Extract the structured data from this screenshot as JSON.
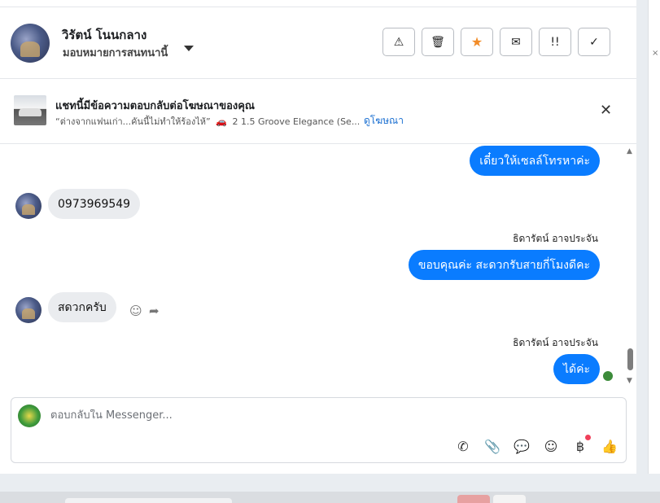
{
  "header": {
    "contact_name": "วิรัตน์ โนนกลาง",
    "assign_label": "มอบหมายการสนทนานี้",
    "actions": [
      {
        "icon": "warning-icon",
        "glyph": "⚠"
      },
      {
        "icon": "trash-icon",
        "glyph": "🗑"
      },
      {
        "icon": "star-icon",
        "glyph": "★"
      },
      {
        "icon": "envelope-icon",
        "glyph": "✉"
      },
      {
        "icon": "priority-icon",
        "glyph": "!!"
      },
      {
        "icon": "check-icon",
        "glyph": "✓"
      }
    ]
  },
  "ad": {
    "title": "แชทนี้มีข้อความตอบกลับต่อโฆษณาของคุณ",
    "quote": "“ต่างจากแฟนเก่า...คันนี้ไม่ทำให้ร้องไห้”",
    "car_icon": "🚗",
    "model": "2 1.5 Groove Elegance (Se...",
    "link": "ดูโฆษณา",
    "close": "✕"
  },
  "messages": [
    {
      "direction": "out",
      "text": "เดี๋ยวให้เซลล์โทรหาค่ะ"
    },
    {
      "direction": "in",
      "text": "0973969549"
    },
    {
      "direction": "out",
      "sender": "ธิดารัตน์ อาจประจัน",
      "text": "ขอบคุณค่ะ สะดวกรับสายกี่โมงดีคะ"
    },
    {
      "direction": "in",
      "text": "สดวกครับ",
      "react_glyph": "☺",
      "reply_glyph": "➦"
    },
    {
      "direction": "out",
      "sender": "ธิดารัตน์ อาจประจัน",
      "text": "ได้ค่ะ"
    }
  ],
  "composer": {
    "placeholder": "ตอบกลับใน Messenger...",
    "tools": [
      {
        "icon": "call-add-icon",
        "glyph": "✆"
      },
      {
        "icon": "paperclip-icon",
        "glyph": "📎"
      },
      {
        "icon": "chat-bubble-icon",
        "glyph": "💬"
      },
      {
        "icon": "emoji-icon",
        "glyph": "☺"
      },
      {
        "icon": "baht-icon",
        "glyph": "฿"
      },
      {
        "icon": "thumbs-up-icon",
        "glyph": "👍"
      }
    ]
  },
  "scroll": {
    "up": "▲",
    "down": "▼"
  },
  "colors": {
    "accent": "#0a7cff",
    "incoming": "#eaecef",
    "star": "#f28c28",
    "link": "#1a6fd1"
  }
}
